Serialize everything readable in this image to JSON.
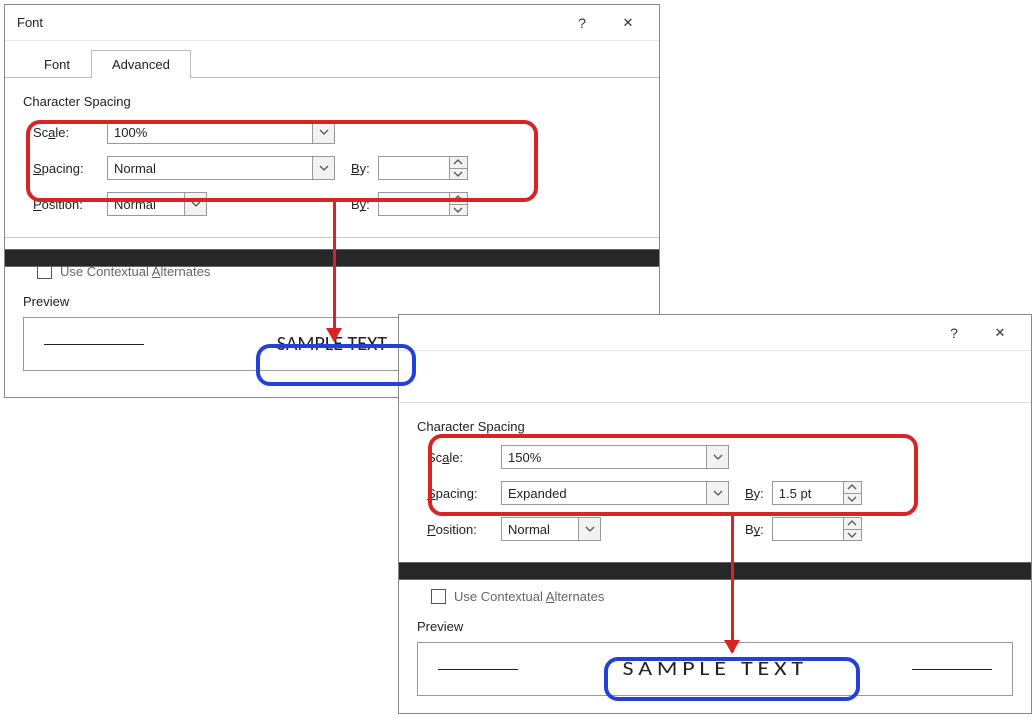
{
  "dialog1": {
    "title": "Font",
    "helpLabel": "?",
    "closeLabel": "✕",
    "tabs": {
      "font": "Font",
      "advanced": "Advanced"
    },
    "group": "Character Spacing",
    "scale": {
      "label_pre": "Sc",
      "label_u": "a",
      "label_post": "le:",
      "value": "100%"
    },
    "spacing": {
      "label_pre": "",
      "label_u": "S",
      "label_post": "pacing:",
      "value": "Normal",
      "by_pre": "",
      "by_u": "B",
      "by_post": "y:",
      "by_value": ""
    },
    "position": {
      "label_pre": "",
      "label_u": "P",
      "label_post": "osition:",
      "value": "Normal",
      "by_pre": "B",
      "by_u": "y",
      "by_post": ":",
      "by_value": ""
    },
    "alternates": {
      "pre": "Use Contextual ",
      "u": "A",
      "post": "lternates"
    },
    "previewLabel": "Preview",
    "sample": "SAMPLE TEXT"
  },
  "dialog2": {
    "helpLabel": "?",
    "closeLabel": "✕",
    "group": "Character Spacing",
    "scale": {
      "label_pre": "Sc",
      "label_u": "a",
      "label_post": "le:",
      "value": "150%"
    },
    "spacing": {
      "label_pre": "",
      "label_u": "S",
      "label_post": "pacing:",
      "value": "Expanded",
      "by_pre": "",
      "by_u": "B",
      "by_post": "y:",
      "by_value": "1.5 pt"
    },
    "position": {
      "label_pre": "",
      "label_u": "P",
      "label_post": "osition:",
      "value": "Normal",
      "by_pre": "B",
      "by_u": "y",
      "by_post": ":",
      "by_value": ""
    },
    "alternates": {
      "pre": "Use Contextual ",
      "u": "A",
      "post": "lternates"
    },
    "previewLabel": "Preview",
    "sample": "SAMPLE TEXT"
  }
}
